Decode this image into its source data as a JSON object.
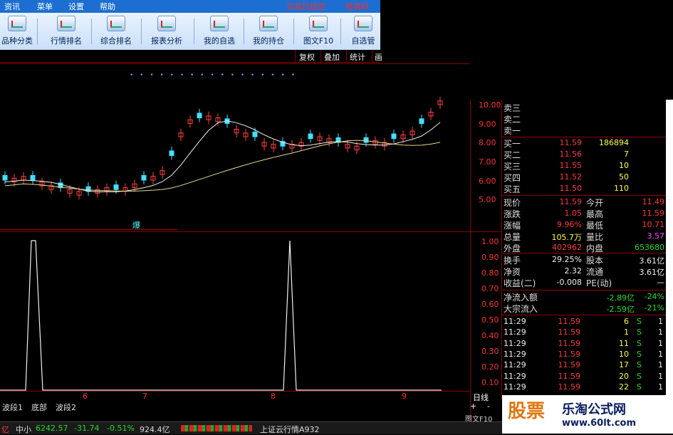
{
  "menu": [
    "资讯",
    "菜单",
    "设置",
    "帮助"
  ],
  "lock_status": "交易已锁定",
  "stock_name": "哈高科",
  "toolbar": [
    {
      "label": "品种分类",
      "icon": "category-icon"
    },
    {
      "label": "行情排名",
      "icon": "ranking-icon"
    },
    {
      "label": "综合排名",
      "icon": "composite-ranking-icon"
    },
    {
      "label": "报表分析",
      "icon": "report-icon"
    },
    {
      "label": "我的自选",
      "icon": "favorites-icon"
    },
    {
      "label": "我的持仓",
      "icon": "holdings-icon"
    },
    {
      "label": "图文F10",
      "icon": "f10-icon"
    },
    {
      "label": "自选管",
      "icon": "manage-icon"
    }
  ],
  "options": [
    "复权",
    "叠加",
    "统计",
    "画"
  ],
  "indicator_label": "爆",
  "price_axis": [
    "10.00",
    "9.00",
    "8.00",
    "7.00",
    "6.00",
    "5.00"
  ],
  "indicator_axis": [
    "1.00",
    "0.90",
    "0.80",
    "0.70",
    "0.60",
    "0.50",
    "0.40",
    "0.30",
    "0.20",
    "0.10"
  ],
  "date_axis": [
    "6",
    "7",
    "8",
    "9"
  ],
  "period": "日线",
  "plus_minus": [
    "+",
    "-"
  ],
  "f10_small": "图文F10",
  "asks": [
    {
      "label": "卖三"
    },
    {
      "label": "卖二"
    },
    {
      "label": "卖一"
    }
  ],
  "bids": [
    {
      "label": "买一",
      "price": "11.59",
      "vol": "186894"
    },
    {
      "label": "买二",
      "price": "11.56",
      "vol": "7"
    },
    {
      "label": "买三",
      "price": "11.55",
      "vol": "10"
    },
    {
      "label": "买四",
      "price": "11.52",
      "vol": "50"
    },
    {
      "label": "买五",
      "price": "11.50",
      "vol": "110"
    }
  ],
  "quote": [
    {
      "l1": "现价",
      "v1": "11.59",
      "c1": "red",
      "l2": "今开",
      "v2": "11.49",
      "c2": "red"
    },
    {
      "l1": "涨跌",
      "v1": "1.05",
      "c1": "red",
      "l2": "最高",
      "v2": "11.59",
      "c2": "red"
    },
    {
      "l1": "涨幅",
      "v1": "9.96%",
      "c1": "red",
      "l2": "最低",
      "v2": "10.71",
      "c2": "red"
    },
    {
      "l1": "总量",
      "v1": "105.7万",
      "c1": "yellow",
      "l2": "量比",
      "v2": "3.57",
      "c2": "magenta"
    },
    {
      "l1": "外盘",
      "v1": "402962",
      "c1": "red",
      "l2": "内盘",
      "v2": "653680",
      "c2": "green"
    }
  ],
  "fundamentals": [
    {
      "l1": "换手",
      "v1": "29.25%",
      "l2": "股本",
      "v2": "3.61亿"
    },
    {
      "l1": "净资",
      "v1": "2.32",
      "l2": "流通",
      "v2": "3.61亿"
    },
    {
      "l1": "收益(二)",
      "v1": "-0.008",
      "l2": "PE(动)",
      "v2": "—"
    }
  ],
  "flows": [
    {
      "label": "净流入额",
      "amount": "-2.89亿",
      "pct": "-24%"
    },
    {
      "label": "大宗流入",
      "amount": "-2.59亿",
      "pct": "-21%"
    }
  ],
  "ticks": [
    {
      "time": "11:29",
      "price": "11.59",
      "vol": "6",
      "side": "S",
      "n": "1"
    },
    {
      "time": "11:29",
      "price": "11.59",
      "vol": "1",
      "side": "S",
      "n": "1"
    },
    {
      "time": "11:29",
      "price": "11.59",
      "vol": "11",
      "side": "S",
      "n": "1"
    },
    {
      "time": "11:29",
      "price": "11.59",
      "vol": "10",
      "side": "S",
      "n": "1"
    },
    {
      "time": "11:29",
      "price": "11.59",
      "vol": "17",
      "side": "S",
      "n": "1"
    },
    {
      "time": "11:29",
      "price": "11.59",
      "vol": "20",
      "side": "S",
      "n": "1"
    },
    {
      "time": "11:29",
      "price": "11.59",
      "vol": "22",
      "side": "S",
      "n": "1"
    }
  ],
  "bottom_tabs": [
    "波段1",
    "底部",
    "波段2"
  ],
  "status": {
    "prefix": "亿",
    "index_name": "中小",
    "index_value": "6242.57",
    "index_change": "-31.74",
    "index_pct": "-0.51%",
    "index_amount": "924.4亿",
    "server": "上证云行情A932"
  },
  "watermark": {
    "logo": "股票",
    "site": "乐淘公式网",
    "url": "www.60lt.com"
  },
  "colors": {
    "up": "#ff3838",
    "down": "#22dd22",
    "grid": "#8b0000",
    "accent": "#1c6fd1"
  }
}
